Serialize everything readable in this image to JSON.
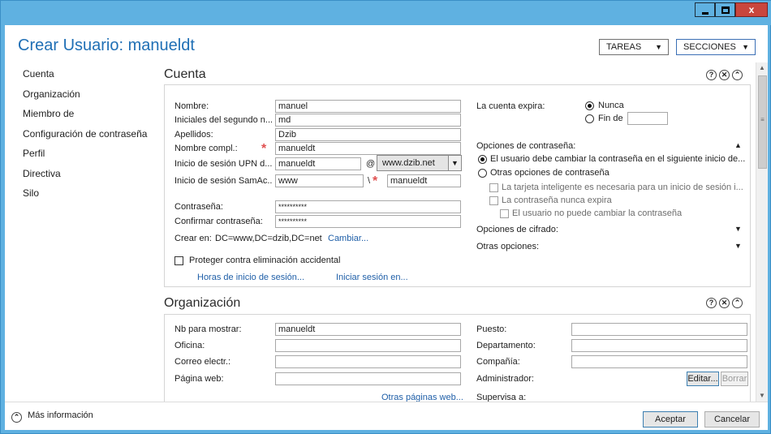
{
  "window": {
    "minimize_glyph": "",
    "maximize_glyph": "",
    "close_glyph": "x"
  },
  "header": {
    "title": "Crear Usuario: manueldt",
    "tareas": "TAREAS",
    "secciones": "SECCIONES",
    "dropdown_arrow": "▼"
  },
  "nav": {
    "items": [
      "Cuenta",
      "Organización",
      "Miembro de",
      "Configuración de contraseña",
      "Perfil",
      "Directiva",
      "Silo"
    ]
  },
  "icons": {
    "help": "?",
    "close": "✕",
    "collapse": "⌃",
    "expand_up": "▲",
    "expand_down": "▼",
    "scroll_up": "▲",
    "scroll_down": "▼",
    "grip": "≡",
    "required": "*"
  },
  "cuenta": {
    "title": "Cuenta",
    "nombre_label": "Nombre:",
    "nombre_value": "manuel",
    "iniciales_label": "Iniciales del segundo n...",
    "iniciales_value": "md",
    "apellidos_label": "Apellidos:",
    "apellidos_value": "Dzib",
    "nombre_compl_label": "Nombre compl.:",
    "nombre_compl_value": "manueldt",
    "upn_label": "Inicio de sesión UPN d...",
    "upn_value": "manueldt",
    "upn_at": "@",
    "upn_domain": "www.dzib.net",
    "sam_label": "Inicio de sesión SamAc...",
    "sam_domain": "www",
    "sam_sep": "\\",
    "sam_value": "manueldt",
    "contrasena_label": "Contraseña:",
    "contrasena_value": "**********",
    "confirmar_label": "Confirmar contraseña:",
    "confirmar_value": "**********",
    "crear_en_label": "Crear en:",
    "crear_en_value": "DC=www,DC=dzib,DC=net",
    "cambiar_link": "Cambiar...",
    "proteger_label": "Proteger contra eliminación accidental",
    "horas_link": "Horas de inicio de sesión...",
    "iniciar_link": "Iniciar sesión en...",
    "expira_label": "La cuenta expira:",
    "nunca_label": "Nunca",
    "fin_de_label": "Fin de",
    "fin_de_value": "",
    "opciones_contrasena": "Opciones de contraseña:",
    "debe_cambiar": "El usuario debe cambiar la contraseña en el siguiente inicio de...",
    "otras_opciones_contrasena": "Otras opciones de contraseña",
    "tarjeta": "La tarjeta inteligente es necesaria para un inicio de sesión i...",
    "nunca_expira": "La contraseña nunca expira",
    "no_puede_cambiar": "El usuario no puede cambiar la contraseña",
    "opciones_cifrado": "Opciones de cifrado:",
    "otras_opciones": "Otras opciones:"
  },
  "organizacion": {
    "title": "Organización",
    "nb_label": "Nb para mostrar:",
    "nb_value": "manueldt",
    "oficina_label": "Oficina:",
    "oficina_value": "",
    "correo_label": "Correo electr.:",
    "correo_value": "",
    "web_label": "Página web:",
    "web_value": "",
    "otras_paginas_link": "Otras páginas web...",
    "puesto_label": "Puesto:",
    "puesto_value": "",
    "departamento_label": "Departamento:",
    "departamento_value": "",
    "compania_label": "Compañía:",
    "compania_value": "",
    "administrador_label": "Administrador:",
    "editar_button": "Editar...",
    "borrar_button": "Borrar",
    "supervisa_label": "Supervisa a:"
  },
  "footer": {
    "mas_informacion": "Más información",
    "aceptar": "Aceptar",
    "cancelar": "Cancelar"
  }
}
